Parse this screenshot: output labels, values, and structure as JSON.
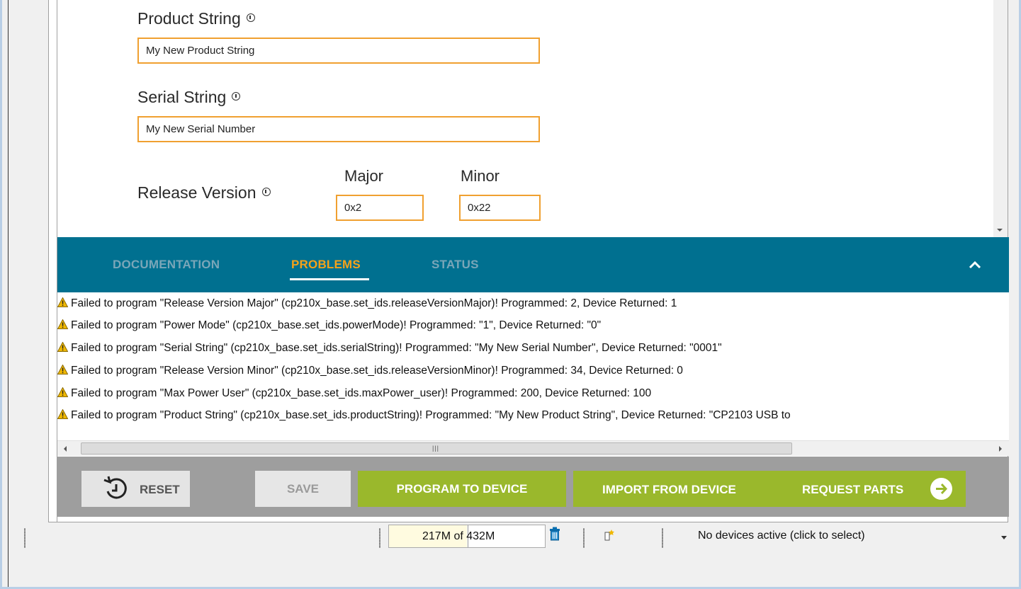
{
  "form": {
    "product_string": {
      "label": "Product String",
      "value": "My New Product String"
    },
    "serial_string": {
      "label": "Serial String",
      "value": "My New Serial Number"
    },
    "release_version": {
      "label": "Release Version",
      "major_label": "Major",
      "major_value": "0x2",
      "minor_label": "Minor",
      "minor_value": "0x22"
    }
  },
  "tabs": [
    {
      "label": "DOCUMENTATION",
      "active": false
    },
    {
      "label": "PROBLEMS",
      "active": true
    },
    {
      "label": "STATUS",
      "active": false
    }
  ],
  "problems": [
    "Failed to program \"Release Version Major\" (cp210x_base.set_ids.releaseVersionMajor)! Programmed: 2, Device Returned: 1",
    "Failed to program \"Power Mode\" (cp210x_base.set_ids.powerMode)! Programmed: \"1\", Device Returned: \"0\"",
    "Failed to program \"Serial String\" (cp210x_base.set_ids.serialString)! Programmed: \"My New Serial Number\", Device Returned: \"0001\"",
    "Failed to program \"Release Version Minor\" (cp210x_base.set_ids.releaseVersionMinor)! Programmed: 34, Device Returned: 0",
    "Failed to program \"Max Power User\" (cp210x_base.set_ids.maxPower_user)! Programmed: 200, Device Returned: 100",
    "Failed to program \"Product String\" (cp210x_base.set_ids.productString)! Programmed: \"My New Product String\", Device Returned: \"CP2103 USB to"
  ],
  "actions": {
    "reset": "RESET",
    "save": "SAVE",
    "program": "PROGRAM TO DEVICE",
    "import": "IMPORT FROM DEVICE",
    "request": "REQUEST PARTS"
  },
  "status": {
    "memory": "217M of 432M",
    "memory_used_fraction": 0.502,
    "devices": "No devices active (click to select)"
  },
  "colors": {
    "tabbar": "#007090",
    "active_tab": "#f6a21a",
    "input_border": "#f0a030",
    "action_green": "#9ab82c",
    "warning": "#f0b800"
  },
  "icons": [
    "info-icon",
    "warning-icon",
    "chevron-up-icon",
    "reset-icon",
    "arrow-right-circle-icon",
    "trash-icon",
    "plug-icon",
    "chevron-down-icon"
  ]
}
